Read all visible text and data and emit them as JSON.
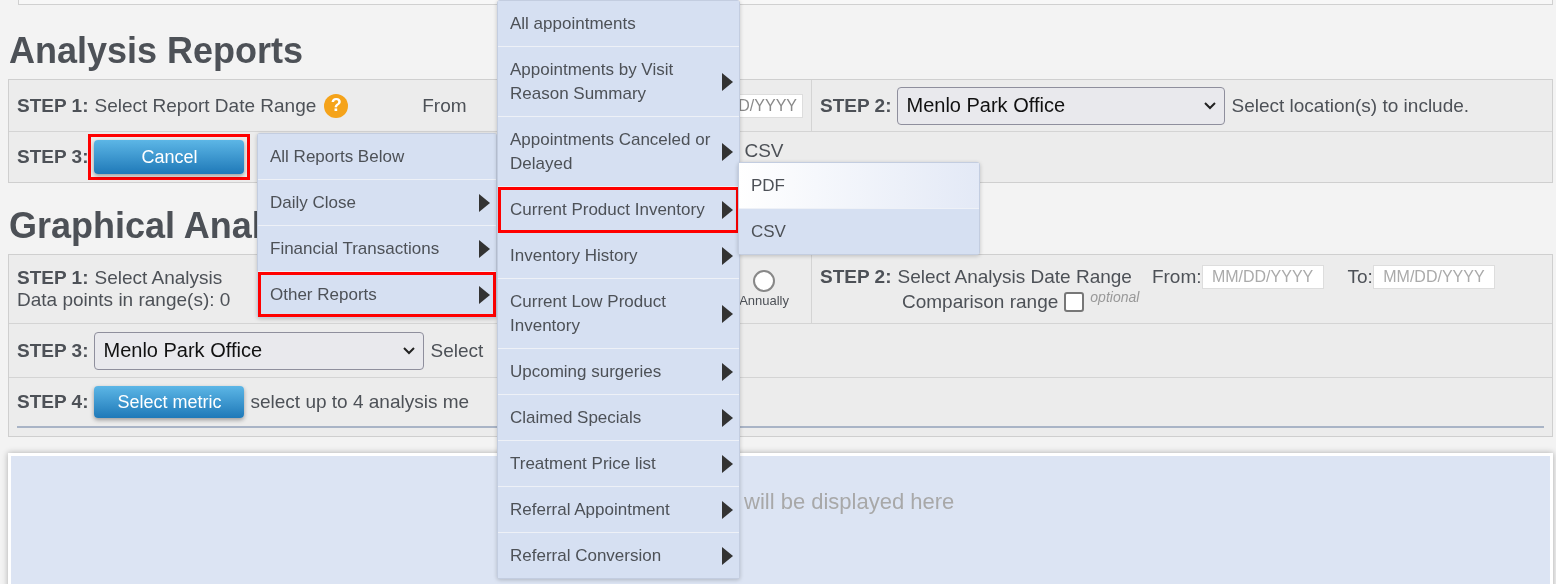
{
  "analysis_reports": {
    "title": "Analysis Reports",
    "step1": {
      "label": "STEP 1:",
      "text": "Select Report Date Range",
      "help": "?",
      "from_label": "From",
      "from_placeholder": "D/YYYY"
    },
    "step2": {
      "label": "STEP 2:",
      "location": "Menlo Park Office",
      "text": "Select location(s) to include."
    },
    "step3": {
      "label": "STEP 3:",
      "button": {
        "label": "Cancel",
        "highlighted": true
      },
      "format": "CSV"
    }
  },
  "graphical_analysis": {
    "title": "Graphical Anal",
    "step1": {
      "label": "STEP 1:",
      "text": "Select Analysis",
      "data_points": "Data points in range(s): 0",
      "radio": {
        "label": "Annually",
        "selected": false
      }
    },
    "step2": {
      "label": "STEP 2:",
      "text": "Select Analysis Date Range",
      "from_label": "From:",
      "from_placeholder": "MM/DD/YYYY",
      "to_label": "To:",
      "to_placeholder": "MM/DD/YYYY",
      "comparison_label": "Comparison range",
      "comparison_checked": false,
      "optional": "optional"
    },
    "step3": {
      "label": "STEP 3:",
      "location": "Menlo Park Office",
      "text": "Select"
    },
    "step4": {
      "label": "STEP 4:",
      "button": "Select metric",
      "text": "select up to 4 analysis me"
    }
  },
  "chart_panel": {
    "message": "will be displayed here"
  },
  "menus": [
    {
      "items": [
        {
          "label": "All Reports Below",
          "has_submenu": false,
          "highlighted": false,
          "hovered": false
        },
        {
          "label": "Daily Close",
          "has_submenu": true,
          "highlighted": false,
          "hovered": false
        },
        {
          "label": "Financial Transactions",
          "has_submenu": true,
          "highlighted": false,
          "hovered": false
        },
        {
          "label": "Other Reports",
          "has_submenu": true,
          "highlighted": true,
          "hovered": false
        }
      ]
    },
    {
      "items": [
        {
          "label": "All appointments",
          "has_submenu": false,
          "highlighted": false,
          "hovered": false
        },
        {
          "label": "Appointments by Visit Reason Summary",
          "has_submenu": true,
          "highlighted": false,
          "hovered": false
        },
        {
          "label": "Appointments Canceled or Delayed",
          "has_submenu": true,
          "highlighted": false,
          "hovered": false
        },
        {
          "label": "Current Product Inventory",
          "has_submenu": true,
          "highlighted": true,
          "hovered": false
        },
        {
          "label": "Inventory History",
          "has_submenu": true,
          "highlighted": false,
          "hovered": false
        },
        {
          "label": "Current Low Product Inventory",
          "has_submenu": true,
          "highlighted": false,
          "hovered": false
        },
        {
          "label": "Upcoming surgeries",
          "has_submenu": true,
          "highlighted": false,
          "hovered": false
        },
        {
          "label": "Claimed Specials",
          "has_submenu": true,
          "highlighted": false,
          "hovered": false
        },
        {
          "label": "Treatment Price list",
          "has_submenu": true,
          "highlighted": false,
          "hovered": false
        },
        {
          "label": "Referral Appointment",
          "has_submenu": true,
          "highlighted": false,
          "hovered": false
        },
        {
          "label": "Referral Conversion",
          "has_submenu": true,
          "highlighted": false,
          "hovered": false
        }
      ]
    },
    {
      "items": [
        {
          "label": "PDF",
          "has_submenu": false,
          "highlighted": false,
          "hovered": true
        },
        {
          "label": "CSV",
          "has_submenu": false,
          "highlighted": false,
          "hovered": false
        }
      ]
    }
  ]
}
